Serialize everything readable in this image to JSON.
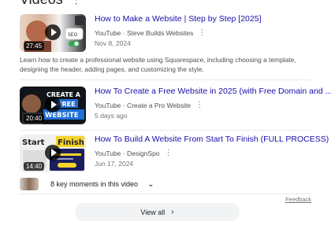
{
  "header": {
    "title": "Videos"
  },
  "videos": [
    {
      "title": "How to Make a Website | Step by Step [2025]",
      "source": "YouTube · Steve Builds Websites",
      "date": "Nov 8, 2024",
      "duration": "27:45",
      "description": "Learn how to create a professional website using Squarespace, including choosing a template, designing the header, adding pages, and customizing the style.",
      "thumb_colors": [
        "#e9d6c4",
        "#b46a4a",
        "#2f3136"
      ]
    },
    {
      "title": "How To Create a Free Website in 2025 (with Free Domain and ...",
      "source": "YouTube · Create a Pro Website",
      "date": "5 days ago",
      "duration": "20:40",
      "thumb_text_1": "CREATE A",
      "thumb_text_2": "FREE",
      "thumb_text_3": "WEBSITE",
      "thumb_colors": [
        "#111418",
        "#1e6fd6",
        "#f3f3f3"
      ]
    },
    {
      "title": "How To Build A Website From Start To Finish (FULL PROCESS)",
      "source": "YouTube · DesignSpo",
      "date": "Jun 17, 2024",
      "duration": "14:40",
      "thumb_text_1": "Start",
      "thumb_text_2": "Finish",
      "thumb_colors": [
        "#f0f0f0",
        "#f6d42a",
        "#1b1f5e"
      ]
    }
  ],
  "key_moments": {
    "label": "8 key moments in this video"
  },
  "feedback": "Feedback",
  "view_all": "View all"
}
